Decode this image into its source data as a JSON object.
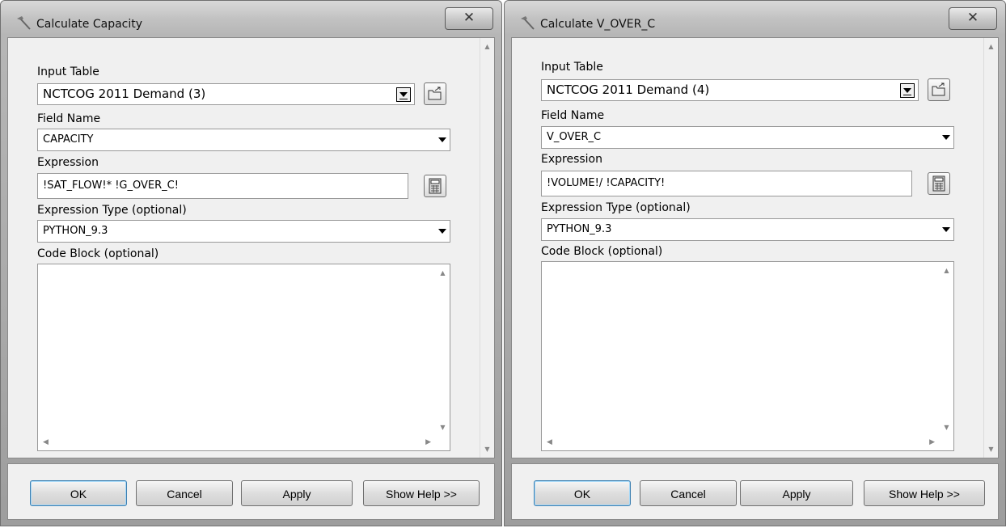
{
  "dialogs": [
    {
      "title": "Calculate Capacity",
      "input_table_label": "Input Table",
      "input_table_value": "NCTCOG 2011 Demand (3)",
      "field_name_label": "Field Name",
      "field_name_value": "CAPACITY",
      "expression_label": "Expression",
      "expression_value": "!SAT_FLOW!* !G_OVER_C!",
      "expression_type_label": "Expression Type (optional)",
      "expression_type_value": "PYTHON_9.3",
      "code_block_label": "Code Block (optional)",
      "buttons": {
        "ok": "OK",
        "cancel": "Cancel",
        "apply": "Apply",
        "help": "Show Help >>"
      }
    },
    {
      "title": "Calculate V_OVER_C",
      "input_table_label": "Input Table",
      "input_table_value": "NCTCOG 2011 Demand (4)",
      "field_name_label": "Field Name",
      "field_name_value": "V_OVER_C",
      "expression_label": "Expression",
      "expression_value": "!VOLUME!/ !CAPACITY!",
      "expression_type_label": "Expression Type (optional)",
      "expression_type_value": "PYTHON_9.3",
      "code_block_label": "Code Block (optional)",
      "buttons": {
        "ok": "OK",
        "cancel": "Cancel",
        "apply": "Apply",
        "help": "Show Help >>"
      }
    }
  ],
  "icons": {
    "title": "hammer-icon",
    "close": "close-icon",
    "browse": "open-folder-icon",
    "calculator": "calculator-icon"
  },
  "colors": {
    "dialog_frame": "#a9a9a9",
    "panel": "#f0f0f0",
    "ok_border": "#3c7fb1"
  }
}
